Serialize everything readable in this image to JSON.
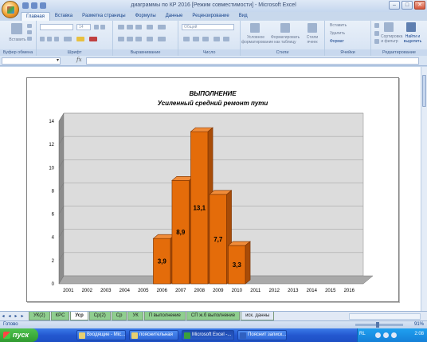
{
  "window": {
    "title": "диаграммы по КР 2016  [Режим совместимости] - Microsoft Excel",
    "min_label": "–",
    "max_label": "□",
    "close_label": "✕"
  },
  "tabs": [
    "Главная",
    "Вставка",
    "Разметка страницы",
    "Формулы",
    "Данные",
    "Рецензирование",
    "Вид"
  ],
  "ribbon": {
    "paste_label": "Вставить",
    "font_name": "",
    "font_size": "14",
    "number_format": "Общий",
    "conditional_format": "Условное форматирование",
    "format_table": "Форматировать как таблицу",
    "cell_styles": "Стили ячеек",
    "insert_cells": "Вставить",
    "delete_cells": "Удалить",
    "format_cells": "Формат",
    "sort_filter": "Сортировка и фильтр",
    "find_select": "Найти и выделить",
    "groups": [
      "Буфер обмена",
      "Шрифт",
      "Выравнивание",
      "Число",
      "Стили",
      "Ячейки",
      "Редактирование"
    ]
  },
  "formula_bar": {
    "fx_label": "fx",
    "name_value": "",
    "formula_value": ""
  },
  "chart_data": {
    "type": "bar",
    "title": "ВЫПОЛНЕНИЕ",
    "subtitle": "Усиленный средний ремонт пути",
    "categories": [
      "2001",
      "2002",
      "2003",
      "2004",
      "2005",
      "2006",
      "2007",
      "2008",
      "2009",
      "2010",
      "2011",
      "2012",
      "2013",
      "2014",
      "2015",
      "2016"
    ],
    "values": [
      null,
      null,
      null,
      null,
      null,
      3.9,
      8.9,
      13.1,
      7.7,
      3.3,
      null,
      null,
      null,
      null,
      null,
      null
    ],
    "data_labels": [
      "",
      "",
      "",
      "",
      "",
      "3,9",
      "8,9",
      "13,1",
      "7,7",
      "3,3",
      "",
      "",
      "",
      "",
      "",
      ""
    ],
    "ylim": [
      0,
      14
    ],
    "yticks": [
      0,
      2,
      4,
      6,
      8,
      10,
      12,
      14
    ],
    "bar_color": "#e46c0a",
    "grid": true,
    "style": "3d"
  },
  "sheet_tabs": [
    "УК(2)",
    "КРС",
    "Уср",
    "Ср(2)",
    "Ср",
    "УК",
    "П выполнение",
    "СП ж.б выполнение",
    "иск. данны"
  ],
  "active_sheet": "Уср",
  "status": {
    "ready": "Готово",
    "zoom": "91%"
  },
  "taskbar": {
    "start_label": "пуск",
    "tasks": [
      "Входящие - Mic...",
      "пояснительная",
      "Microsoft Excel -...",
      "Пояснит записк..."
    ],
    "lang": "RL",
    "time": "2:08"
  }
}
